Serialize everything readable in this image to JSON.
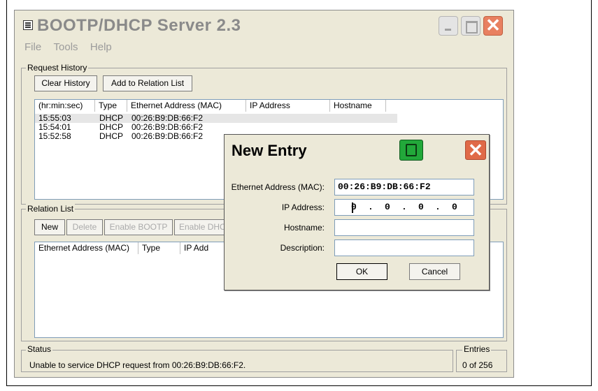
{
  "window": {
    "title": "BOOTP/DHCP Server 2.3"
  },
  "menu": [
    "File",
    "Tools",
    "Help"
  ],
  "request_history": {
    "label": "Request History",
    "clear_button": "Clear History",
    "add_button": "Add to Relation List",
    "columns": [
      "(hr:min:sec)",
      "Type",
      "Ethernet Address (MAC)",
      "IP Address",
      "Hostname"
    ],
    "rows": [
      {
        "time": "15:55:03",
        "type": "DHCP",
        "mac": "00:26:B9:DB:66:F2",
        "ip": "",
        "host": ""
      },
      {
        "time": "15:54:01",
        "type": "DHCP",
        "mac": "00:26:B9:DB:66:F2",
        "ip": "",
        "host": ""
      },
      {
        "time": "15:52:58",
        "type": "DHCP",
        "mac": "00:26:B9:DB:66:F2",
        "ip": "",
        "host": ""
      }
    ]
  },
  "relation_list": {
    "label": "Relation List",
    "buttons": [
      "New",
      "Delete",
      "Enable BOOTP",
      "Enable DHC"
    ],
    "columns": [
      "Ethernet Address (MAC)",
      "Type",
      "IP Add"
    ]
  },
  "status": {
    "label": "Status",
    "message": "Unable to service DHCP request from 00:26:B9:DB:66:F2.",
    "entries_label": "Entries",
    "entries_value": "0 of 256"
  },
  "dialog": {
    "title": "New Entry",
    "mac_label": "Ethernet Address (MAC):",
    "mac_value": "00:26:B9:DB:66:F2",
    "ip_label": "IP Address:",
    "ip_octets": [
      "0",
      "0",
      "0",
      "0"
    ],
    "ip_dot": ".",
    "hostname_label": "Hostname:",
    "hostname_value": "",
    "description_label": "Description:",
    "description_value": "",
    "ok": "OK",
    "cancel": "Cancel"
  }
}
